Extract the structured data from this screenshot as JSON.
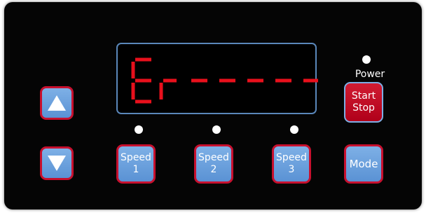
{
  "display": {
    "readout": "Er-----",
    "segment_color": "#e8101c",
    "border_color": "#5a87ba"
  },
  "power": {
    "label": "Power",
    "led_state": "on"
  },
  "buttons": {
    "up": {
      "icon": "up-arrow-icon"
    },
    "down": {
      "icon": "down-arrow-icon"
    },
    "speed1": {
      "line1": "Speed",
      "line2": "1"
    },
    "speed2": {
      "line1": "Speed",
      "line2": "2"
    },
    "speed3": {
      "line1": "Speed",
      "line2": "3"
    },
    "start_stop": {
      "line1": "Start",
      "line2": "Stop"
    },
    "mode": {
      "label": "Mode"
    }
  },
  "colors": {
    "button_fill": "#5a92d4",
    "button_border": "#c8102e",
    "start_fill": "#c8102e",
    "panel": "#050505"
  }
}
